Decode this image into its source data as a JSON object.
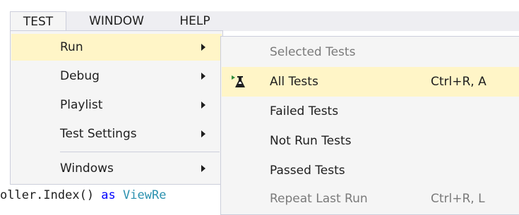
{
  "menubar": {
    "items": [
      {
        "label": "TEST",
        "open": true
      },
      {
        "label": "WINDOW",
        "open": false
      },
      {
        "label": "HELP",
        "open": false
      }
    ]
  },
  "test_menu": {
    "items": [
      {
        "label": "Run",
        "has_submenu": true,
        "highlighted": true
      },
      {
        "label": "Debug",
        "has_submenu": true,
        "highlighted": false
      },
      {
        "label": "Playlist",
        "has_submenu": true,
        "highlighted": false
      },
      {
        "label": "Test Settings",
        "has_submenu": true,
        "highlighted": false
      },
      {
        "label": "Windows",
        "has_submenu": true,
        "highlighted": false
      }
    ]
  },
  "run_submenu": {
    "items": [
      {
        "label": "Selected Tests",
        "shortcut": "",
        "enabled": false,
        "highlighted": false,
        "icon": ""
      },
      {
        "label": "All Tests",
        "shortcut": "Ctrl+R, A",
        "enabled": true,
        "highlighted": true,
        "icon": "run-tests-flask-icon"
      },
      {
        "label": "Failed Tests",
        "shortcut": "",
        "enabled": true,
        "highlighted": false,
        "icon": ""
      },
      {
        "label": "Not Run Tests",
        "shortcut": "",
        "enabled": true,
        "highlighted": false,
        "icon": ""
      },
      {
        "label": "Passed Tests",
        "shortcut": "",
        "enabled": true,
        "highlighted": false,
        "icon": ""
      },
      {
        "label": "Repeat Last Run",
        "shortcut": "Ctrl+R, L",
        "enabled": false,
        "highlighted": false,
        "icon": ""
      }
    ]
  },
  "code_line": {
    "prefix": "oller.Index() ",
    "keyword": "as",
    "space": " ",
    "type_fragment": "ViewRe"
  },
  "colors": {
    "menu_background": "#f5f5f5",
    "menubar_background": "#eeeef2",
    "highlight": "#fff5c7",
    "border": "#cccedb",
    "disabled_text": "#7a7a7a",
    "code_keyword": "#0000ff",
    "code_type": "#2b91af"
  }
}
